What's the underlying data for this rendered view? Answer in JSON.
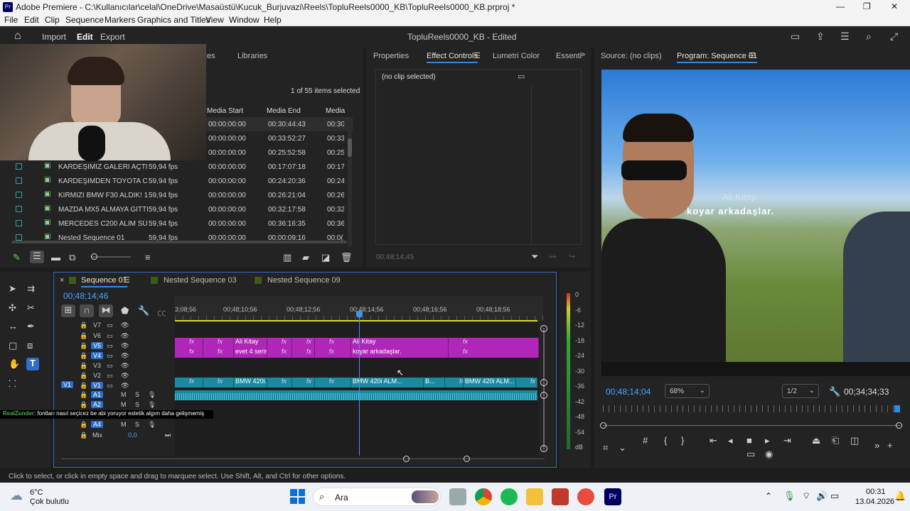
{
  "window": {
    "title": "Adobe Premiere - C:\\Kullanıcılar\\celal\\OneDrive\\Masaüstü\\Kucuk_Burjuvazi\\Reels\\TopluReels0000_KB\\TopluReels0000_KB.prproj *",
    "minimize": "—",
    "maximize": "❐",
    "close": "✕"
  },
  "menu": [
    "File",
    "Edit",
    "Clip",
    "Sequence",
    "Markers",
    "Graphics and Titles",
    "View",
    "Window",
    "Help"
  ],
  "header": {
    "import": "Import",
    "edit": "Edit",
    "export": "Export",
    "project_title": "TopluReels0000_KB - Edited"
  },
  "project": {
    "tab_partial": "tes",
    "tab_libraries": "Libraries",
    "items_selected": "1 of 55 items selected",
    "columns": [
      "Media Start",
      "Media End",
      "Media I"
    ],
    "rows": [
      {
        "name": "",
        "fps": "",
        "start": "00:00:00:00",
        "end": "00:30:44:43",
        "dur": "00:30"
      },
      {
        "name": "",
        "fps": "",
        "start": "00:00:00:00",
        "end": "00:33:52:27",
        "dur": "00:33"
      },
      {
        "name": "",
        "fps": "",
        "start": "00:00:00:00",
        "end": "00:25:52:58",
        "dur": "00:25"
      },
      {
        "name": "KARDEŞİMİZ GALERİ AÇTI! B",
        "fps": "59,94 fps",
        "start": "00:00:00:00",
        "end": "00:17:07:18",
        "dur": "00:17"
      },
      {
        "name": "KARDEŞİMDEN TOYOTA CO",
        "fps": "59,94 fps",
        "start": "00:00:00:00",
        "end": "00:24:20:36",
        "dur": "00:24"
      },
      {
        "name": "KIRMIZI BMW F30 ALDIK! 1.",
        "fps": "59,94 fps",
        "start": "00:00:00:00",
        "end": "00:26:21:04",
        "dur": "00:26"
      },
      {
        "name": "MAZDA MX5 ALMAYA GİTTİ",
        "fps": "59,94 fps",
        "start": "00:00:00:00",
        "end": "00:32:17:58",
        "dur": "00:32"
      },
      {
        "name": "MERCEDES C200 ALIM SÜRE",
        "fps": "59,94 fps",
        "start": "00:00:00:00",
        "end": "00:36:16:35",
        "dur": "00:36"
      },
      {
        "name": "Nested Sequence 01",
        "fps": "59,94 fps",
        "start": "00:00:00:00",
        "end": "00:00:09:16",
        "dur": "00:0("
      }
    ]
  },
  "effects": {
    "tabs": [
      "Properties",
      "Effect Controls",
      "Lumetri Color",
      "Essenti"
    ],
    "no_clip": "(no clip selected)",
    "timecode": "00;48;14;45"
  },
  "program": {
    "source_tab": "Source: (no clips)",
    "program_tab": "Program: Sequence 01",
    "caption_line1": "Ali Kitay",
    "caption_line2": "koyar arkadaşlar.",
    "timecode": "00;48;14;04",
    "zoom": "68%",
    "quality": "1/2",
    "duration": "00;34;34;33"
  },
  "timeline": {
    "tabs": [
      "Sequence 01",
      "Nested Sequence 03",
      "Nested Sequence 09"
    ],
    "timecode": "00;48;14;46",
    "ruler": [
      "3;08;56",
      "00;48;10;56",
      "00;48;12;56",
      "00;48;14;56",
      "00;48;16;56",
      "00;48;18;56"
    ],
    "video_tracks": [
      "V7",
      "V6",
      "V5",
      "V4",
      "V3",
      "V2",
      "V1"
    ],
    "audio_tracks": [
      "A1",
      "A2",
      "A3",
      "A4"
    ],
    "mix_label": "Mix",
    "mix_value": "0,0",
    "v5_clips": [
      "fx",
      "fx",
      "Ali Kitay",
      "fx",
      "fx",
      "fx",
      "Ali Kitay",
      "fx"
    ],
    "v4_clips": [
      "fx",
      "fx",
      "evet 4 seris..",
      "fx",
      "fx",
      "fx",
      "koyar arkadaşlar.",
      "fx"
    ],
    "v1_clips": [
      "fx",
      "fx",
      "BMW 420i..",
      "fx",
      "fx",
      "fx",
      "BMW 420i ALM...",
      "B...",
      "fx",
      "BMW 420i ALM...",
      "fx"
    ],
    "meter_labels": [
      "0",
      "-6",
      "-12",
      "-18",
      "-24",
      "-30",
      "-36",
      "-42",
      "-48",
      "-54",
      "dB"
    ],
    "track_buttons": {
      "m": "M",
      "s": "S"
    }
  },
  "chat_overlay": {
    "user": "RealZunder",
    "message": ": fontları nasıl seçicez be abi yoruyor estetik algım daha gelişmemiş"
  },
  "status_bar": "Click to select, or click in empty space and drag to marquee select. Use Shift, Alt, and Ctrl for other options.",
  "taskbar": {
    "temp": "6°C",
    "weather": "Çok bulutlu",
    "search": "Ara",
    "time": "00:31",
    "date": "13.04.2026"
  },
  "colors": {
    "accent": "#2d8ceb",
    "video_clip": "#b126b8",
    "audio_clip": "#1a8aa1",
    "playhead": "#4a90e2"
  }
}
